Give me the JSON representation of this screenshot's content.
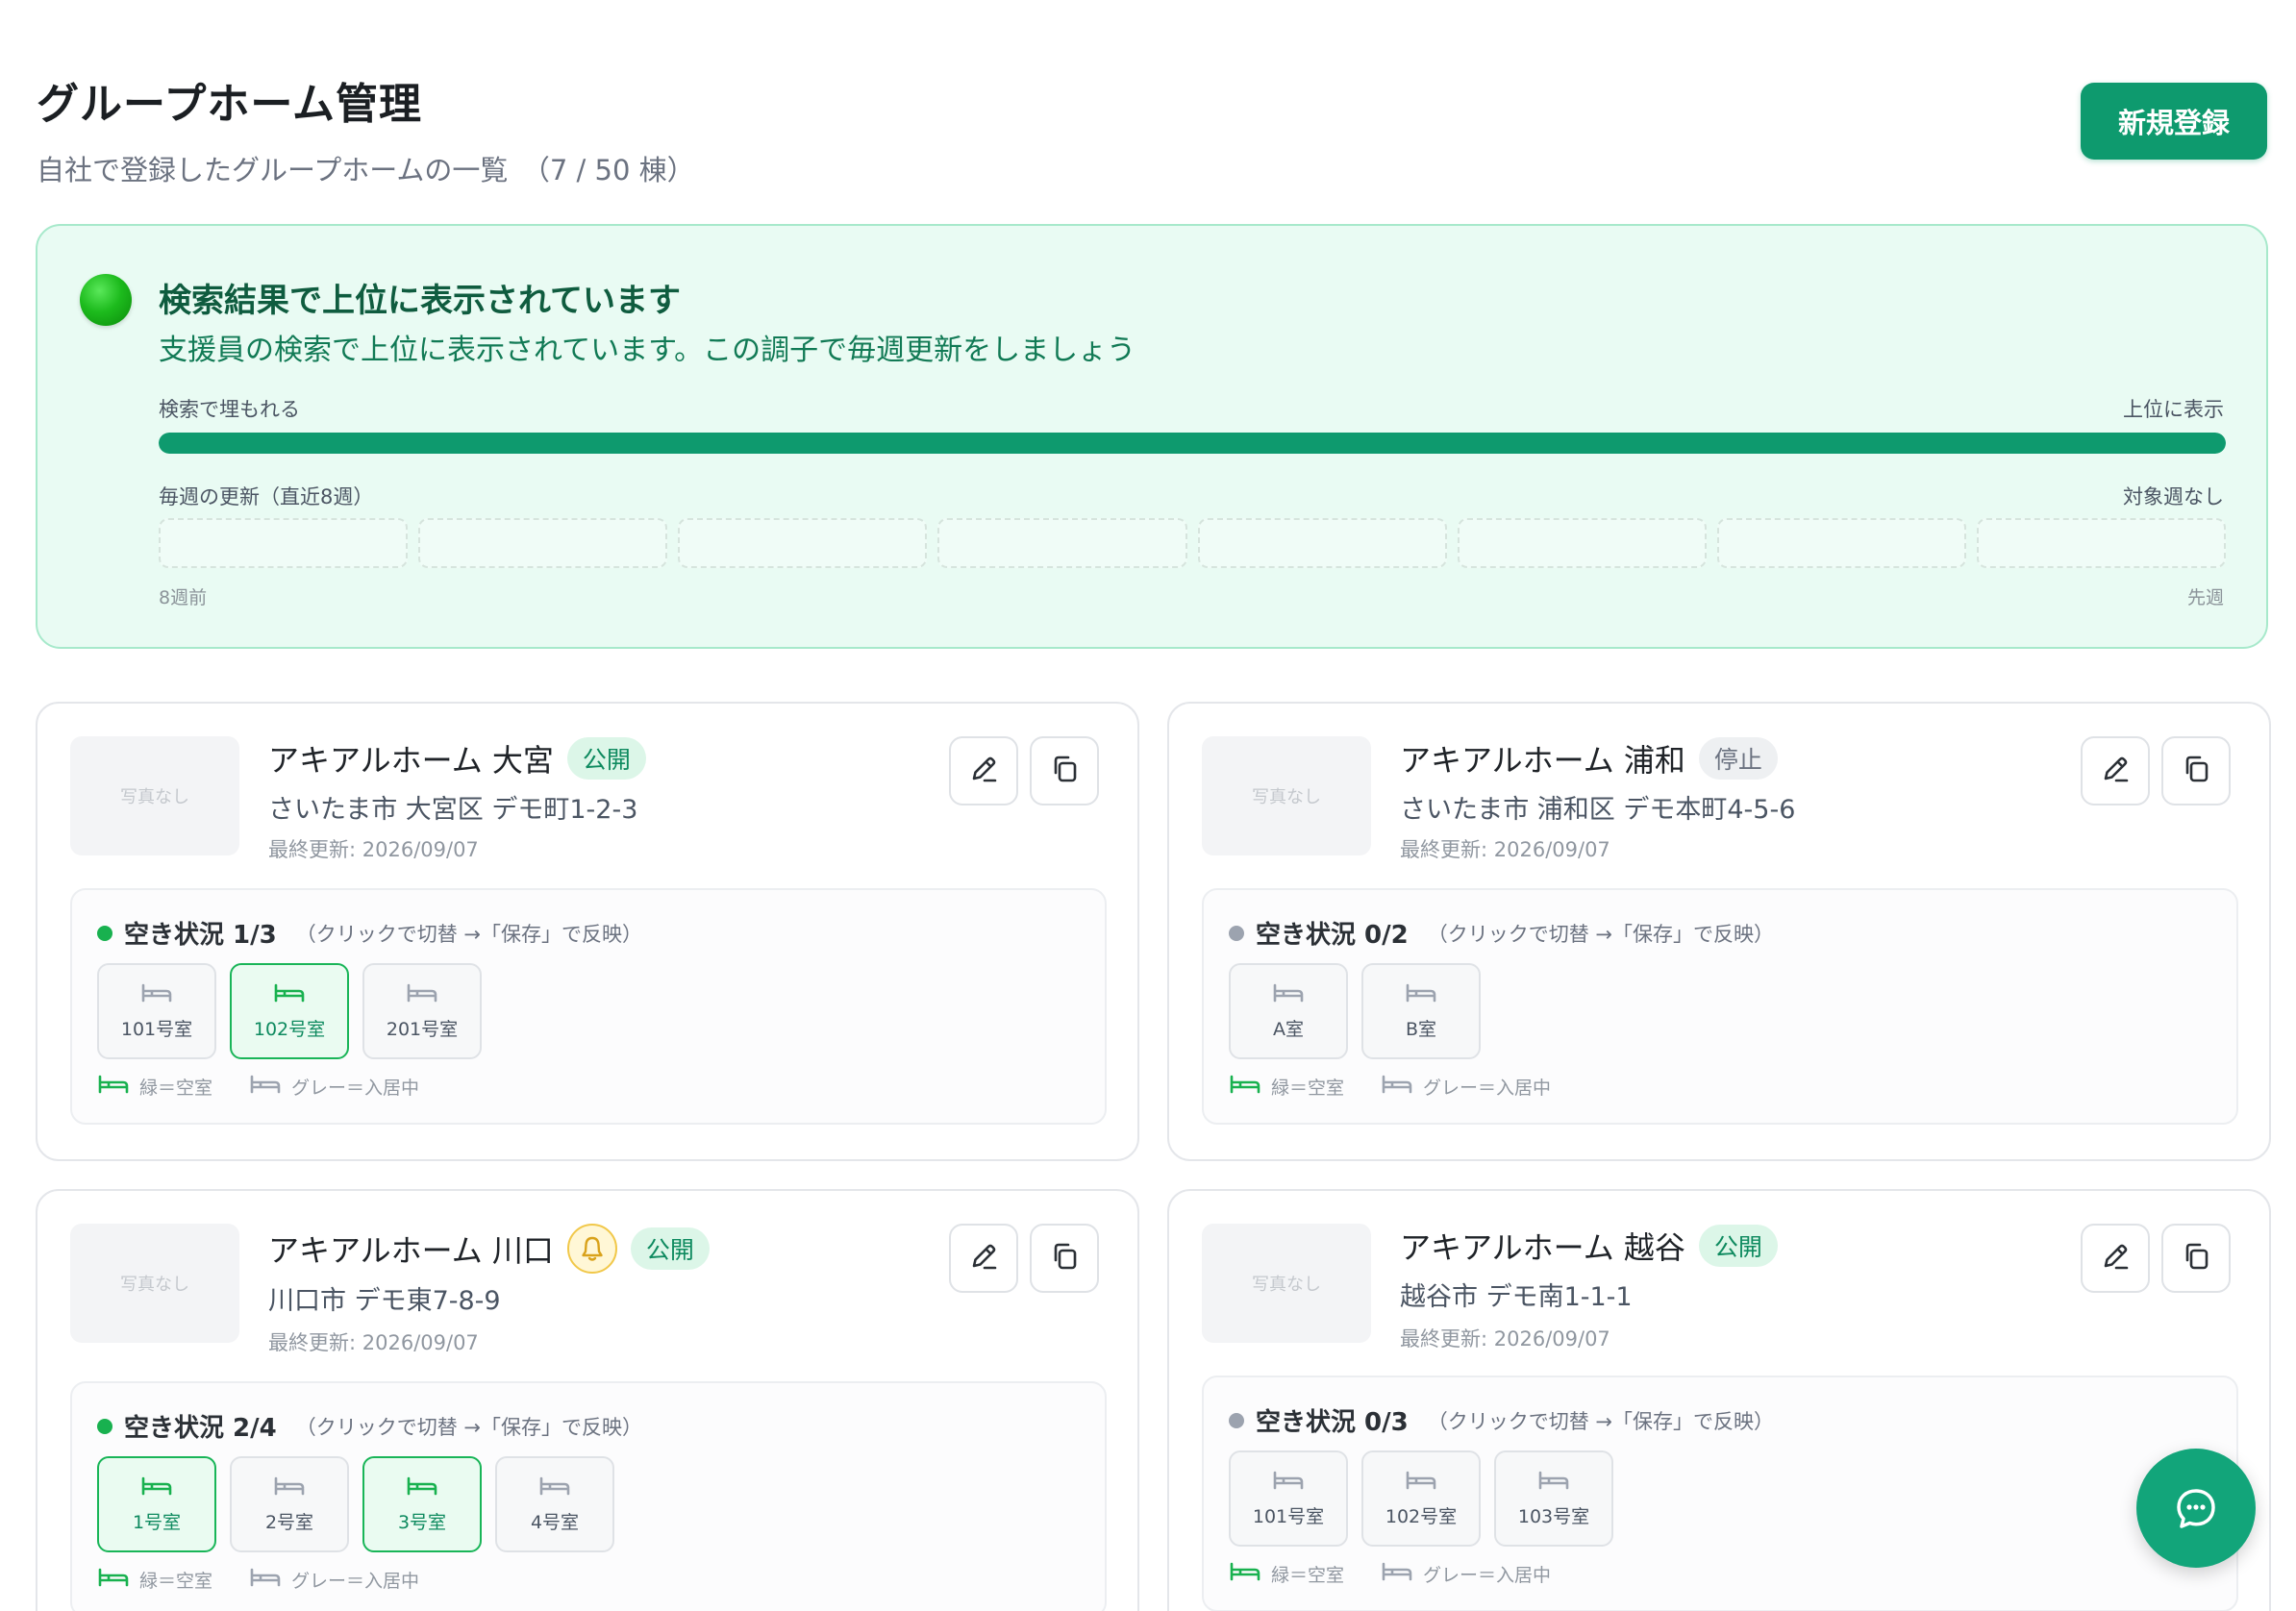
{
  "header": {
    "title": "グループホーム管理",
    "subtitle": "自社で登録したグループホームの一覧　（7 / 50 棟）",
    "new_button": "新規登録"
  },
  "status_panel": {
    "title": "検索結果で上位に表示されています",
    "description": "支援員の検索で上位に表示されています。この調子で毎週更新をしましょう",
    "scale_left": "検索で埋もれる",
    "scale_right": "上位に表示",
    "score_fraction": 1.0,
    "weekly_label": "毎週の更新（直近8週）",
    "weekly_status": "対象週なし",
    "weeks_count": 8,
    "weeks_start": "8週前",
    "weeks_end": "先週",
    "colors": {
      "accent": "#0e9a6e",
      "panel_bg": "#e9fbf3"
    }
  },
  "cards": [
    {
      "photo": "写真なし",
      "name": "アキアルホーム 大宮",
      "status": "公開",
      "status_type": "public",
      "has_bell": false,
      "address": "さいたま市 大宮区 デモ町1-2-3",
      "updated": "最終更新: 2026/09/07",
      "vacancy": "空き状況 1/3",
      "vacancy_hint": "（クリックで切替 →「保存」で反映）",
      "rooms": [
        {
          "label": "101号室",
          "vacant": false
        },
        {
          "label": "102号室",
          "vacant": true
        },
        {
          "label": "201号室",
          "vacant": false
        }
      ]
    },
    {
      "photo": "写真なし",
      "name": "アキアルホーム 浦和",
      "status": "停止",
      "status_type": "stopped",
      "has_bell": false,
      "address": "さいたま市 浦和区 デモ本町4-5-6",
      "updated": "最終更新: 2026/09/07",
      "vacancy": "空き状況 0/2",
      "vacancy_hint": "（クリックで切替 →「保存」で反映）",
      "rooms": [
        {
          "label": "A室",
          "vacant": false
        },
        {
          "label": "B室",
          "vacant": false
        }
      ]
    },
    {
      "photo": "写真なし",
      "name": "アキアルホーム 川口",
      "status": "公開",
      "status_type": "public",
      "has_bell": true,
      "address": "川口市 デモ東7-8-9",
      "updated": "最終更新: 2026/09/07",
      "vacancy": "空き状況 2/4",
      "vacancy_hint": "（クリックで切替 →「保存」で反映）",
      "rooms": [
        {
          "label": "1号室",
          "vacant": true
        },
        {
          "label": "2号室",
          "vacant": false
        },
        {
          "label": "3号室",
          "vacant": true
        },
        {
          "label": "4号室",
          "vacant": false
        }
      ]
    },
    {
      "photo": "写真なし",
      "name": "アキアルホーム 越谷",
      "status": "公開",
      "status_type": "public",
      "has_bell": false,
      "address": "越谷市 デモ南1-1-1",
      "updated": "最終更新: 2026/09/07",
      "vacancy": "空き状況 0/3",
      "vacancy_hint": "（クリックで切替 →「保存」で反映）",
      "rooms": [
        {
          "label": "101号室",
          "vacant": false
        },
        {
          "label": "102号室",
          "vacant": false
        },
        {
          "label": "103号室",
          "vacant": false
        }
      ]
    }
  ],
  "legend": {
    "vacant": "緑＝空室",
    "occupied": "グレー＝入居中"
  },
  "colors": {
    "vacant": "#18b14f",
    "occupied": "#9ca3af",
    "brand": "#12a57a"
  },
  "icons": {
    "edit": "pencil-icon",
    "copy": "copy-icon",
    "bell": "bell-icon",
    "bed": "bed-icon",
    "chat": "chat-icon"
  }
}
